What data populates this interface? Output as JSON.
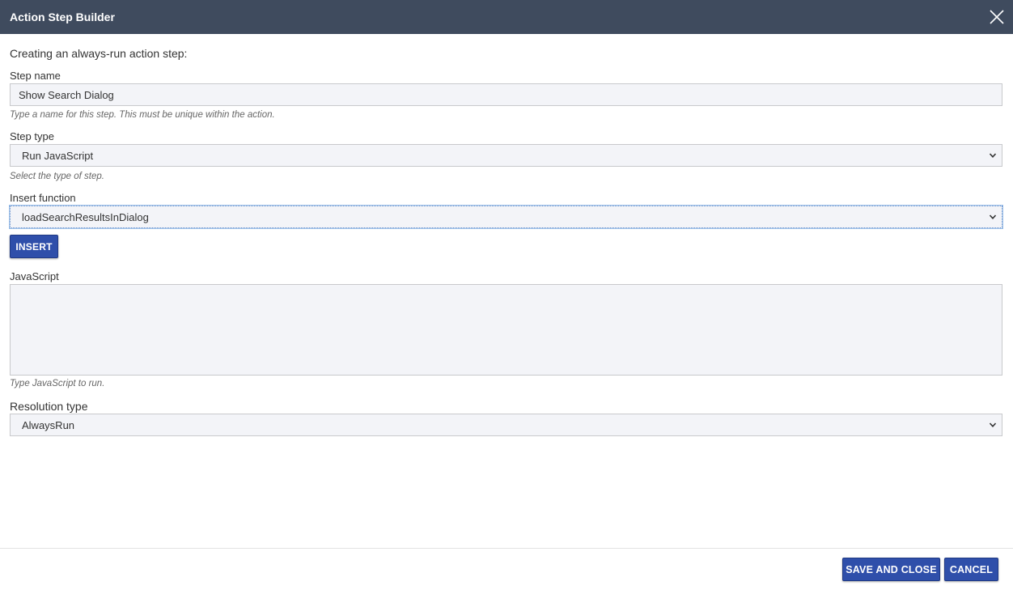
{
  "dialog": {
    "title": "Action Step Builder",
    "intro": "Creating an always-run action step:"
  },
  "step_name": {
    "label": "Step name",
    "value": "Show Search Dialog",
    "hint": "Type a name for this step. This must be unique within the action."
  },
  "step_type": {
    "label": "Step type",
    "selected": "Run JavaScript",
    "hint": "Select the type of step."
  },
  "insert_function": {
    "label": "Insert function",
    "selected": "loadSearchResultsInDialog",
    "button_label": "INSERT"
  },
  "javascript": {
    "label": "JavaScript",
    "value": "",
    "hint": "Type JavaScript to run."
  },
  "resolution_type": {
    "label": "Resolution type",
    "selected": "AlwaysRun"
  },
  "footer": {
    "save_label": "SAVE AND CLOSE",
    "cancel_label": "CANCEL"
  },
  "colors": {
    "titlebar": "#3f4b5e",
    "button": "#2f4faa",
    "field_bg": "#f3f4f8"
  },
  "icons": [
    "close-icon",
    "chevron-down-icon"
  ]
}
